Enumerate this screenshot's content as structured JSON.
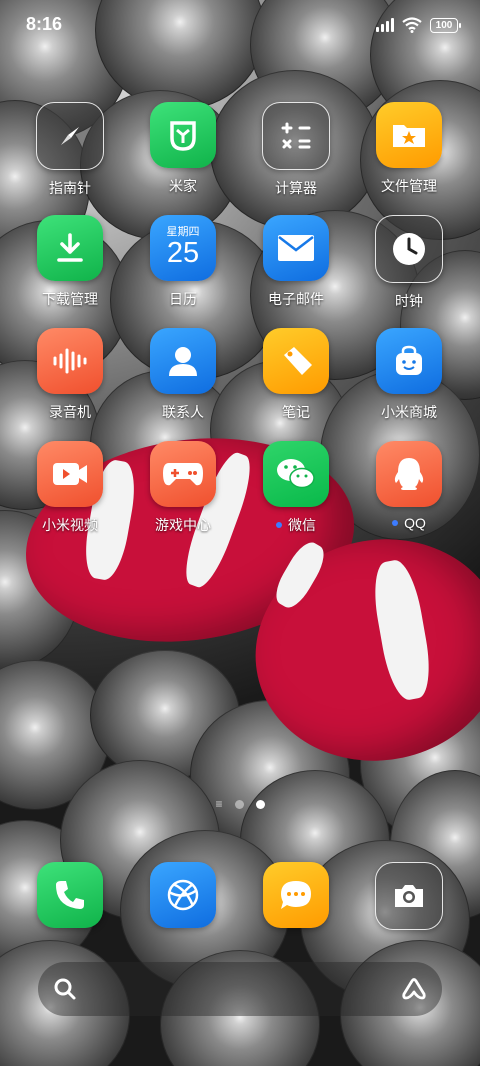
{
  "status_bar": {
    "time": "8:16",
    "battery": "100"
  },
  "apps": [
    {
      "label": "指南针",
      "icon": "compass-icon",
      "style": "glass"
    },
    {
      "label": "米家",
      "icon": "mijia-icon",
      "style": "green"
    },
    {
      "label": "计算器",
      "icon": "calculator-icon",
      "style": "glass"
    },
    {
      "label": "文件管理",
      "icon": "folder-icon",
      "style": "orange"
    },
    {
      "label": "下载管理",
      "icon": "download-icon",
      "style": "green"
    },
    {
      "label": "日历",
      "icon": "calendar-icon",
      "style": "blue",
      "weekday": "星期四",
      "day": "25"
    },
    {
      "label": "电子邮件",
      "icon": "mail-icon",
      "style": "blue"
    },
    {
      "label": "时钟",
      "icon": "clock-icon",
      "style": "glass"
    },
    {
      "label": "录音机",
      "icon": "recorder-icon",
      "style": "coral"
    },
    {
      "label": "联系人",
      "icon": "contacts-icon",
      "style": "blue"
    },
    {
      "label": "笔记",
      "icon": "notes-icon",
      "style": "orange"
    },
    {
      "label": "小米商城",
      "icon": "store-icon",
      "style": "blue"
    },
    {
      "label": "小米视频",
      "icon": "video-icon",
      "style": "coral"
    },
    {
      "label": "游戏中心",
      "icon": "gamepad-icon",
      "style": "coral"
    },
    {
      "label": "微信",
      "icon": "wechat-icon",
      "style": "wechat",
      "new_dot": true
    },
    {
      "label": "QQ",
      "icon": "qq-icon",
      "style": "coral",
      "new_dot": true
    }
  ],
  "dock": [
    {
      "icon": "phone-icon",
      "style": "green"
    },
    {
      "icon": "browser-icon",
      "style": "blue"
    },
    {
      "icon": "messages-icon",
      "style": "orange"
    },
    {
      "icon": "camera-icon",
      "style": "glass"
    }
  ],
  "pager": {
    "pages": 2,
    "active": 2
  },
  "colors": {
    "notification_dot": "#3d7cff",
    "fish": "#c8103a"
  }
}
